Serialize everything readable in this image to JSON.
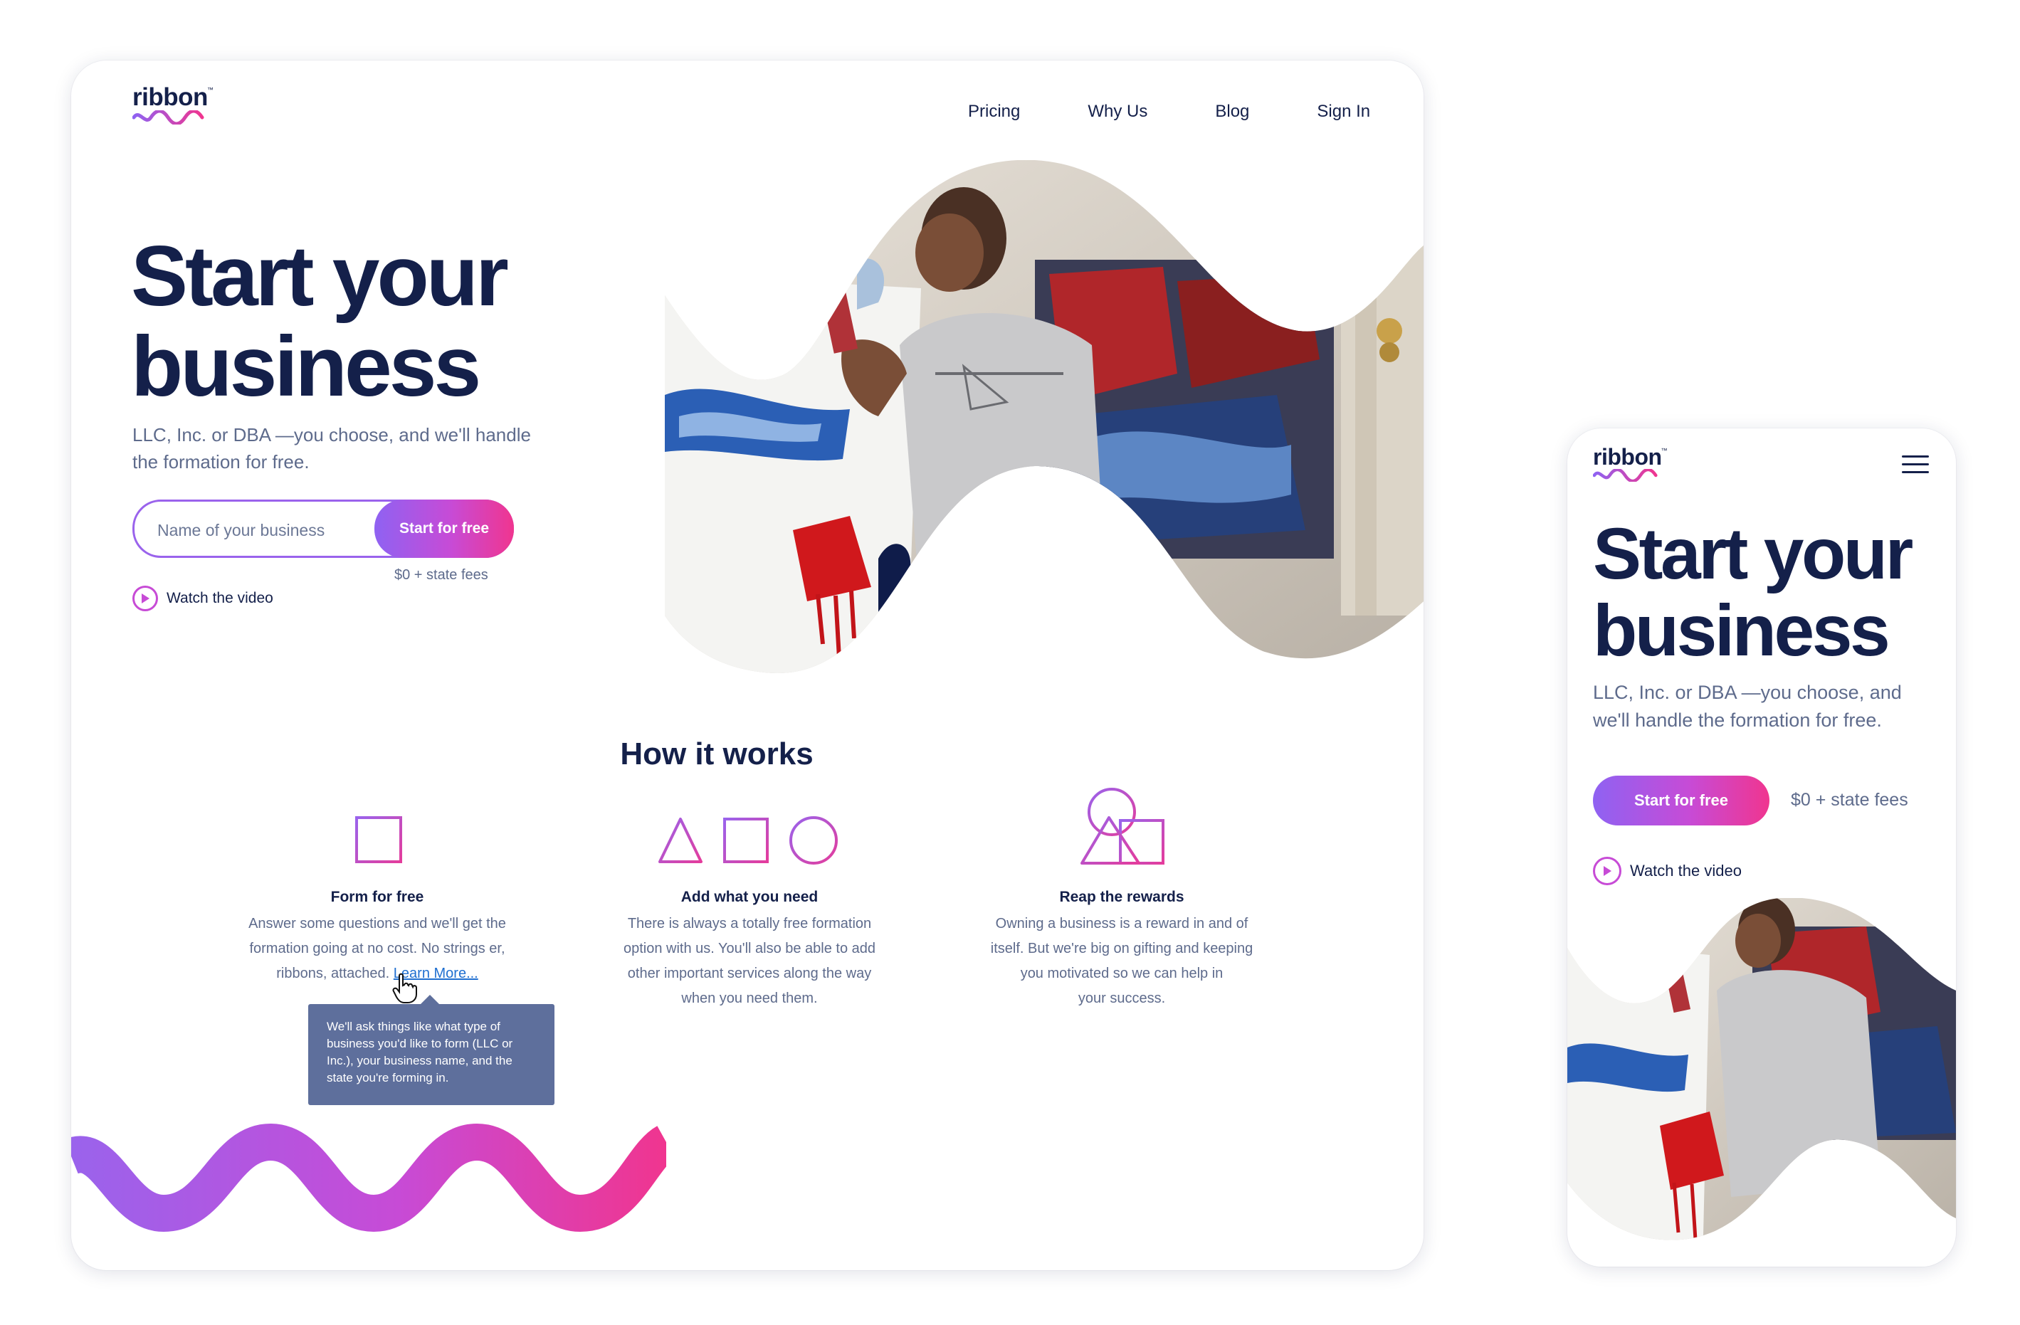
{
  "brand": {
    "logo_text": "ribbon",
    "trademark": "™"
  },
  "nav": {
    "items": [
      {
        "label": "Pricing"
      },
      {
        "label": "Why Us"
      },
      {
        "label": "Blog"
      },
      {
        "label": "Sign In"
      }
    ]
  },
  "hero": {
    "title_line1": "Start your",
    "title_line2": "business",
    "subtitle": "LLC, Inc. or DBA —you choose, and we'll handle the formation for free.",
    "input_placeholder": "Name of your business",
    "cta_label": "Start for free",
    "fees": "$0 + state fees",
    "watch_video": "Watch the video"
  },
  "how_it_works": {
    "title": "How it works",
    "steps": [
      {
        "title": "Form for free",
        "desc_lines": [
          "Answer some questions and we'll get the",
          "formation going at no cost. No strings er,"
        ],
        "desc_last": "ribbons, attached.",
        "link": "Learn More...",
        "icon": "square-icon"
      },
      {
        "title": "Add what you need",
        "desc_lines": [
          "There is always a totally free formation",
          "option with us. You'll also be able to add",
          "other important services along the way",
          "when you need them."
        ],
        "icon": "triangle-square-circle-icons"
      },
      {
        "title": "Reap the rewards",
        "desc_lines": [
          "Owning a business is a reward in and of",
          "itself. But we're big on gifting and keeping",
          "you motivated so we can help in",
          "your success."
        ],
        "icon": "stacked-shapes-icon"
      }
    ]
  },
  "tooltip": {
    "text": "We'll ask things like what type of business you'd like to form (LLC or Inc.), your business name, and the state you're forming in."
  },
  "mobile": {
    "title_line1": "Start your",
    "title_line2": "business",
    "subtitle": "LLC, Inc. or DBA —you choose, and we'll handle the formation for free.",
    "cta_label": "Start for free",
    "fees": "$0 + state fees",
    "watch_video": "Watch the video"
  },
  "colors": {
    "navy": "#14204a",
    "muted": "#5e6b8c",
    "purple": "#8f62f2",
    "magenta": "#c74bd6",
    "pink": "#f0358f",
    "tooltip_bg": "#5e6f9c",
    "link": "#1f6fd0"
  }
}
